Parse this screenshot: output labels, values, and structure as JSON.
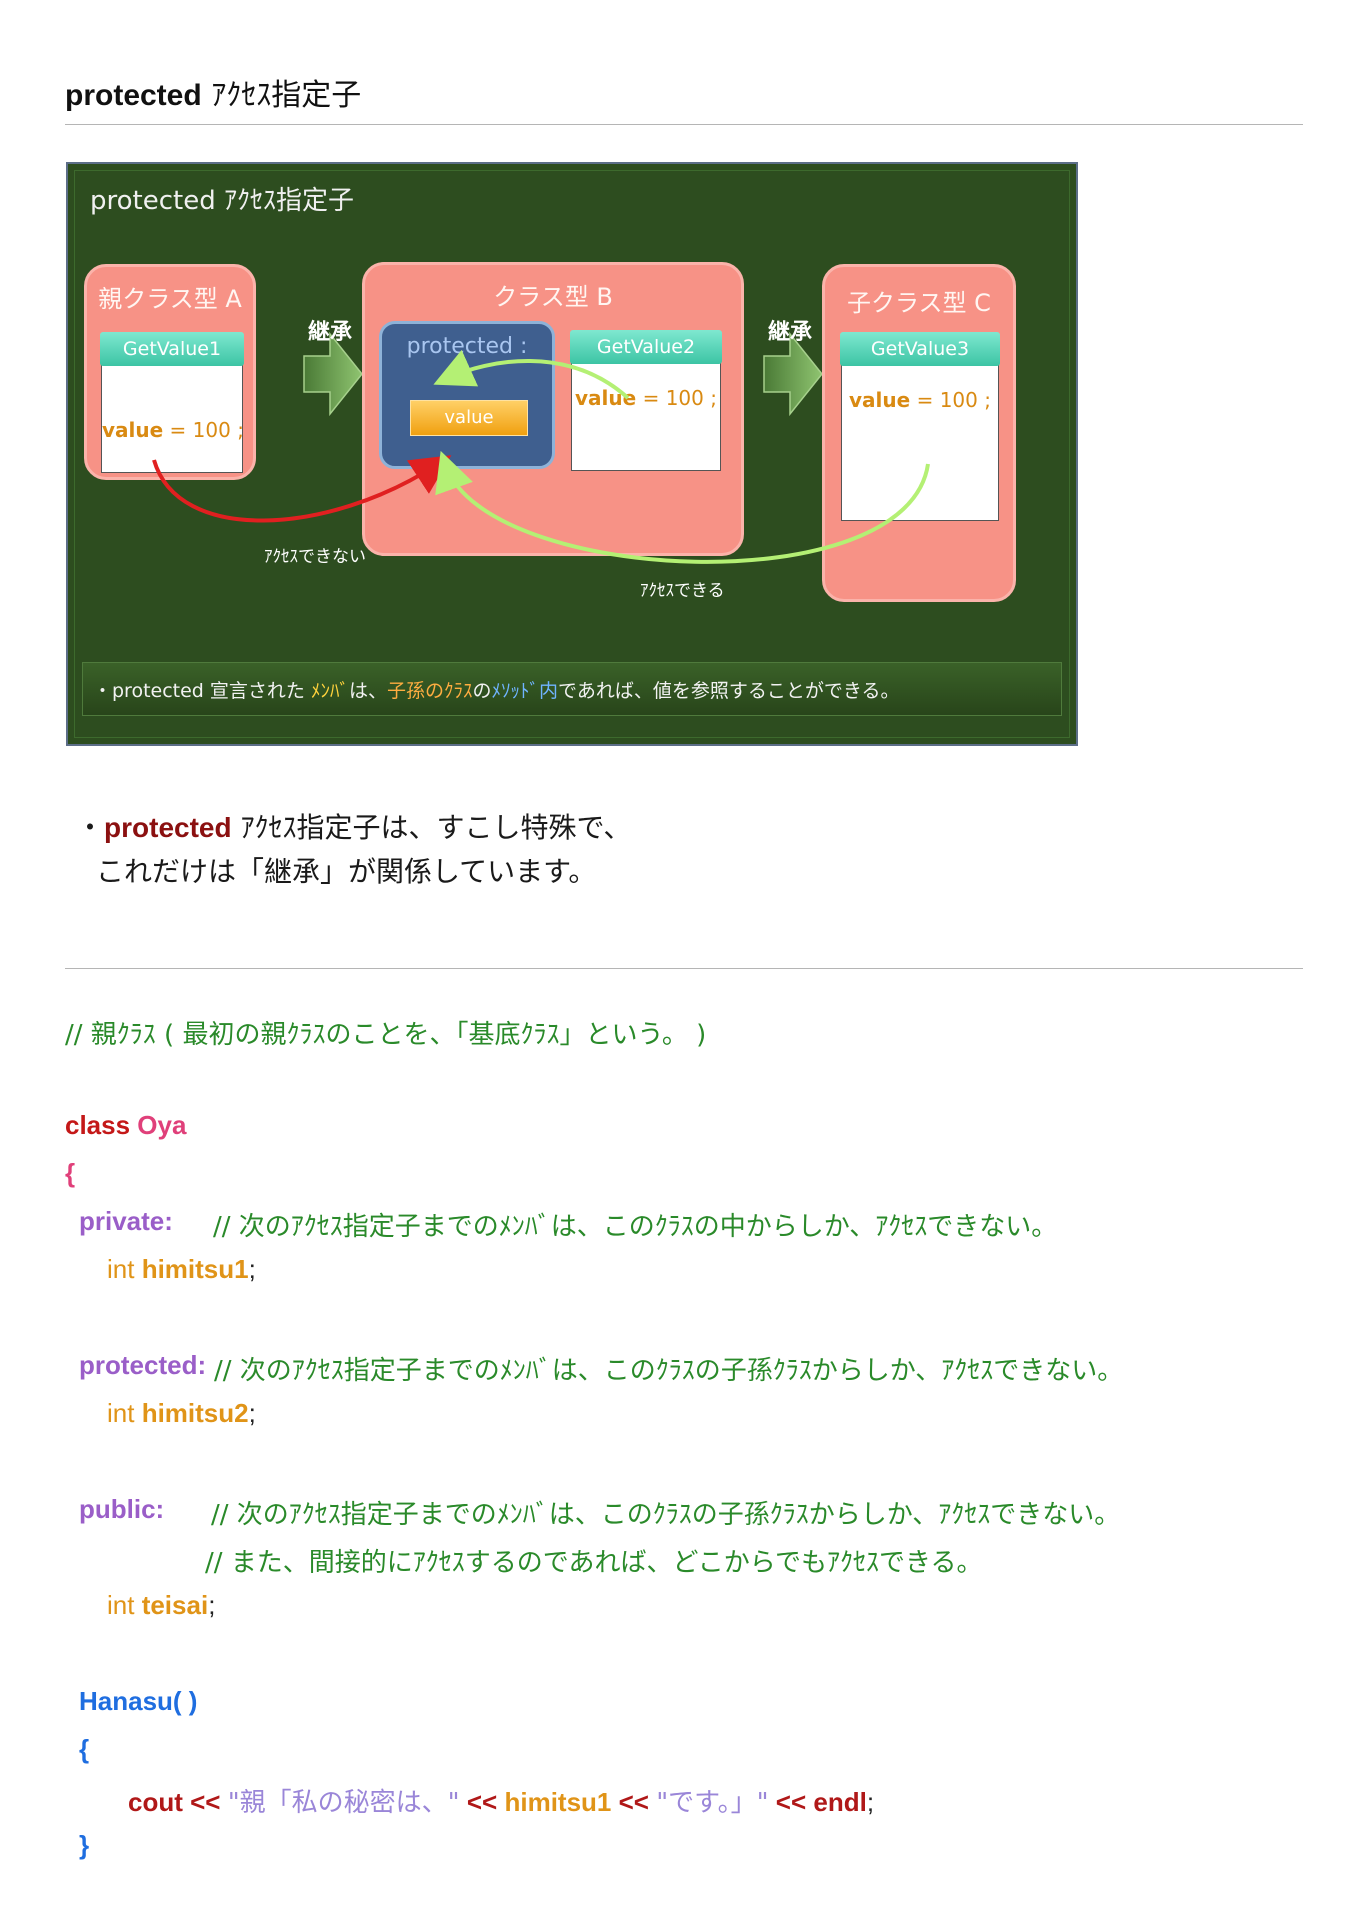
{
  "heading": {
    "en": "protected",
    "ja": " ｱｸｾｽ指定子"
  },
  "diagram": {
    "title": "protected ｱｸｾｽ指定子",
    "class_a": {
      "label": "親クラス型 A",
      "method": "GetValue1",
      "value_name": "value",
      "value_rest": " = 100 ;"
    },
    "class_b": {
      "label": "クラス型 B",
      "protected_label": "protected :",
      "value_button": "value",
      "method": "GetValue2",
      "value_name": "value",
      "value_rest": " = 100 ;"
    },
    "class_c": {
      "label": "子クラス型 C",
      "method": "GetValue3",
      "value_name": "value",
      "value_rest": " = 100 ;"
    },
    "inherit_1": "継承",
    "inherit_2": "継承",
    "cannot_access": "ｱｸｾｽできない",
    "can_access": "ｱｸｾｽできる",
    "bar": {
      "p1": "・protected 宣言された ",
      "p2": "ﾒﾝﾊﾞ",
      "p3": "は、",
      "p4": "子孫のｸﾗｽ",
      "p5": "の",
      "p6": "ﾒｿｯﾄﾞ内",
      "p7": "であれば、値を参照することができる。"
    },
    "colors": {
      "board": "#2d4d1f",
      "class_fill": "#f79286",
      "protected_fill": "#3f5f8f",
      "method_header": "#3cc4a4",
      "can_arrow": "#b4f074",
      "cannot_arrow": "#e02020"
    }
  },
  "note": {
    "bullet": "・",
    "red": "protected",
    "l1_rest": " ｱｸｾｽ指定子は、すこし特殊で、",
    "l2": "これだけは「継承」が関係しています。"
  },
  "code": {
    "comment1": "// 親ｸﾗｽ ( 最初の親ｸﾗｽのことを、「基底ｸﾗｽ」という。 )",
    "class_kw": "class",
    "class_name": " Oya",
    "brace_open": "{",
    "private_kw": "private:",
    "private_comment": "// 次のｱｸｾｽ指定子までのﾒﾝﾊﾞは、このｸﾗｽの中からしか、ｱｸｾｽできない。",
    "int1": "int ",
    "var1": "himitsu1",
    "semi1": ";",
    "protected_kw": "protected:",
    "protected_comment": " // 次のｱｸｾｽ指定子までのﾒﾝﾊﾞは、このｸﾗｽの子孫ｸﾗｽからしか、ｱｸｾｽできない。",
    "int2": "int ",
    "var2": "himitsu2",
    "semi2": ";",
    "public_kw": "public:",
    "public_comment1": "// 次のｱｸｾｽ指定子までのﾒﾝﾊﾞは、このｸﾗｽの子孫ｸﾗｽからしか、ｱｸｾｽできない。",
    "public_comment2": "// また、間接的にｱｸｾｽするのであれば、どこからでもｱｸｾｽできる。",
    "int3": "int ",
    "var3": "teisai",
    "semi3": ";",
    "method": "Hanasu( )",
    "method_open": "{",
    "cout": "cout",
    "op1": " << ",
    "str1": "\"親「私の秘密は、\"",
    "op2": " << ",
    "var_out": "himitsu1",
    "op3": " << ",
    "str2": "\"です。」\"",
    "op4": " << ",
    "endl": "endl",
    "semi4": ";",
    "method_close": "}"
  }
}
